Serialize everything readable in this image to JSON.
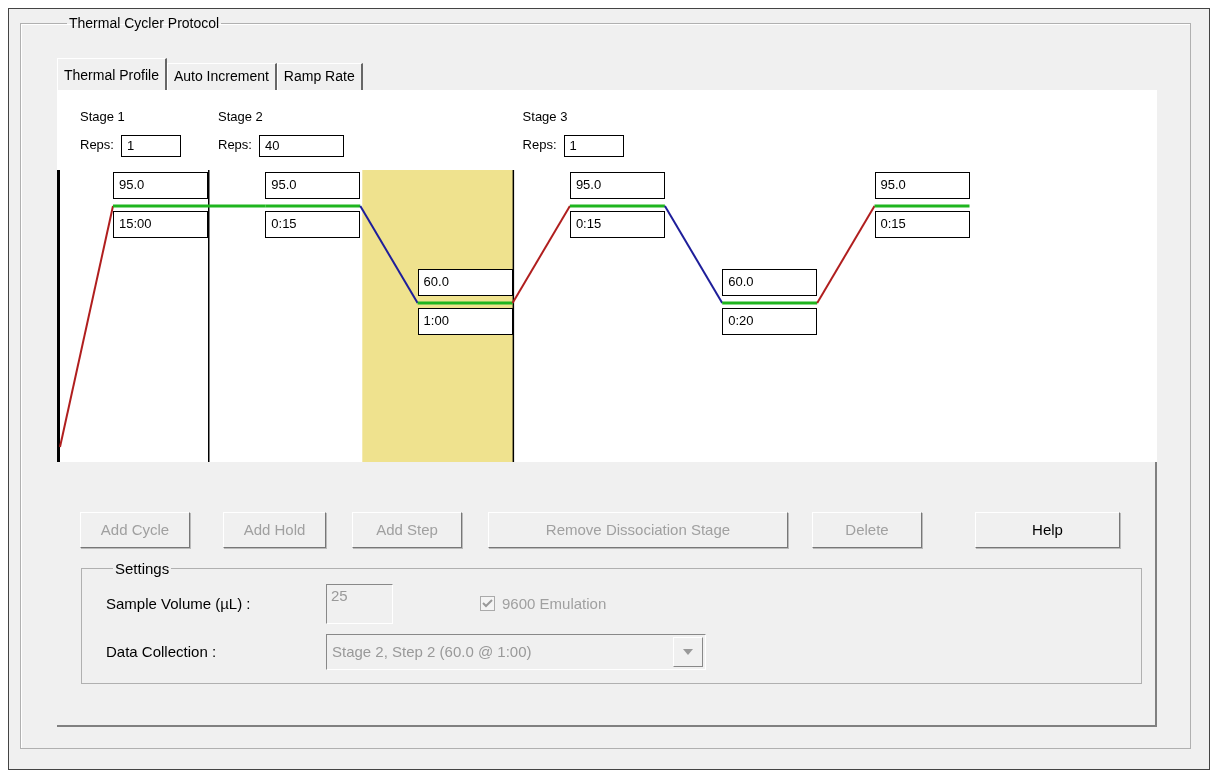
{
  "group_title": "Thermal Cycler Protocol",
  "tabs": [
    {
      "label": "Thermal Profile",
      "selected": true
    },
    {
      "label": "Auto Increment",
      "selected": false
    },
    {
      "label": "Ramp Rate",
      "selected": false
    }
  ],
  "profile": {
    "stages": [
      {
        "title": "Stage 1",
        "reps_label": "Reps:",
        "reps": "1",
        "steps": [
          {
            "temperature": "95.0",
            "time": "15:00",
            "selected": false
          }
        ]
      },
      {
        "title": "Stage 2",
        "reps_label": "Reps:",
        "reps": "40",
        "steps": [
          {
            "temperature": "95.0",
            "time": "0:15",
            "selected": false
          },
          {
            "temperature": "60.0",
            "time": "1:00",
            "selected": true
          }
        ]
      },
      {
        "title": "Stage 3",
        "reps_label": "Reps:",
        "reps": "1",
        "steps": [
          {
            "temperature": "95.0",
            "time": "0:15",
            "selected": false
          },
          {
            "temperature": "60.0",
            "time": "0:20",
            "selected": false
          },
          {
            "temperature": "95.0",
            "time": "0:15",
            "selected": false
          }
        ]
      }
    ]
  },
  "buttons": [
    {
      "label": "Add Cycle",
      "disabled": true
    },
    {
      "label": "Add Hold",
      "disabled": true
    },
    {
      "label": "Add Step",
      "disabled": true
    },
    {
      "label": "Remove Dissociation Stage",
      "disabled": true
    },
    {
      "label": "Delete",
      "disabled": true
    },
    {
      "label": "Help",
      "disabled": false
    }
  ],
  "settings": {
    "title": "Settings",
    "sample_volume": {
      "label": "Sample Volume (µL) :",
      "value": "25",
      "disabled": true
    },
    "emulation": {
      "label": "9600 Emulation",
      "checked": true,
      "disabled": true
    },
    "data_collection": {
      "label": "Data Collection :",
      "value": "Stage 2, Step 2 (60.0 @ 1:00)",
      "disabled": true
    }
  }
}
